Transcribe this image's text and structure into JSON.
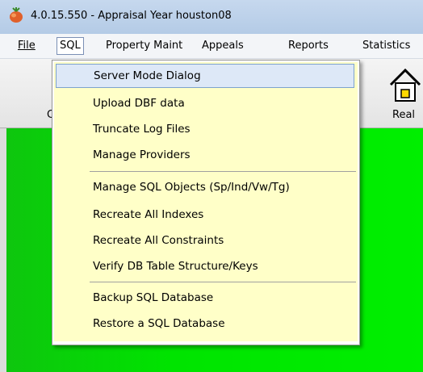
{
  "window": {
    "title": "4.0.15.550 - Appraisal Year houston08"
  },
  "menubar": {
    "file": "File",
    "sql": "SQL",
    "property_maint": "Property Maint",
    "appeals": "Appeals",
    "reports": "Reports",
    "statistics": "Statistics"
  },
  "toolbar": {
    "left_label": "C",
    "right_label": "Real"
  },
  "sql_menu": {
    "items": [
      "Server Mode Dialog",
      "Upload DBF data",
      "Truncate Log Files",
      "Manage Providers",
      "Manage SQL Objects (Sp/Ind/Vw/Tg)",
      "Recreate All Indexes",
      "Recreate All Constraints",
      "Verify DB Table Structure/Keys",
      "Backup SQL Database",
      "Restore a SQL Database"
    ],
    "highlighted": "Server Mode Dialog"
  },
  "colors": {
    "content_bg": "#00e400",
    "menu_bg": "#ffffc8",
    "highlight": "#dde8f7"
  }
}
